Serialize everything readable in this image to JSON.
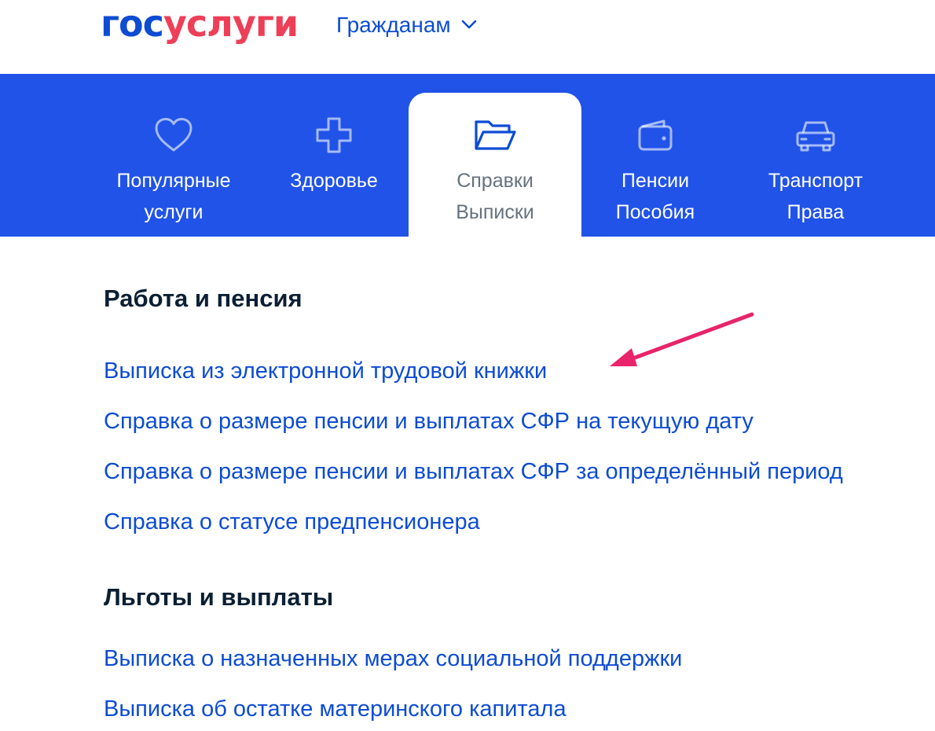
{
  "header": {
    "logo_part1": "гос",
    "logo_part2": "услуги",
    "audience_label": "Гражданам",
    "audience_icon": "chevron-down-icon"
  },
  "tabs": [
    {
      "line1": "Популярные",
      "line2": "услуги",
      "icon": "heart-icon",
      "active": false
    },
    {
      "line1": "Здоровье",
      "line2": "",
      "icon": "medical-cross-icon",
      "active": false
    },
    {
      "line1": "Справки",
      "line2": "Выписки",
      "icon": "folder-icon",
      "active": true
    },
    {
      "line1": "Пенсии",
      "line2": "Пособия",
      "icon": "wallet-icon",
      "active": false
    },
    {
      "line1": "Транспорт",
      "line2": "Права",
      "icon": "car-icon",
      "active": false
    }
  ],
  "sections": [
    {
      "title": "Работа и пенсия",
      "links": [
        "Выписка из электронной трудовой книжки",
        "Справка о размере пенсии и выплатах СФР на текущую дату",
        "Справка о размере пенсии и выплатах СФР за определённый период",
        "Справка о статусе предпенсионера"
      ]
    },
    {
      "title": "Льготы и выплаты",
      "links": [
        "Выписка о назначенных мерах социальной поддержки",
        "Выписка об остатке материнского капитала"
      ]
    }
  ],
  "colors": {
    "brand_blue": "#0d4cd3",
    "brand_red": "#ee3f58",
    "tab_bar": "#2153e8",
    "annotation_arrow": "#e8246a"
  }
}
